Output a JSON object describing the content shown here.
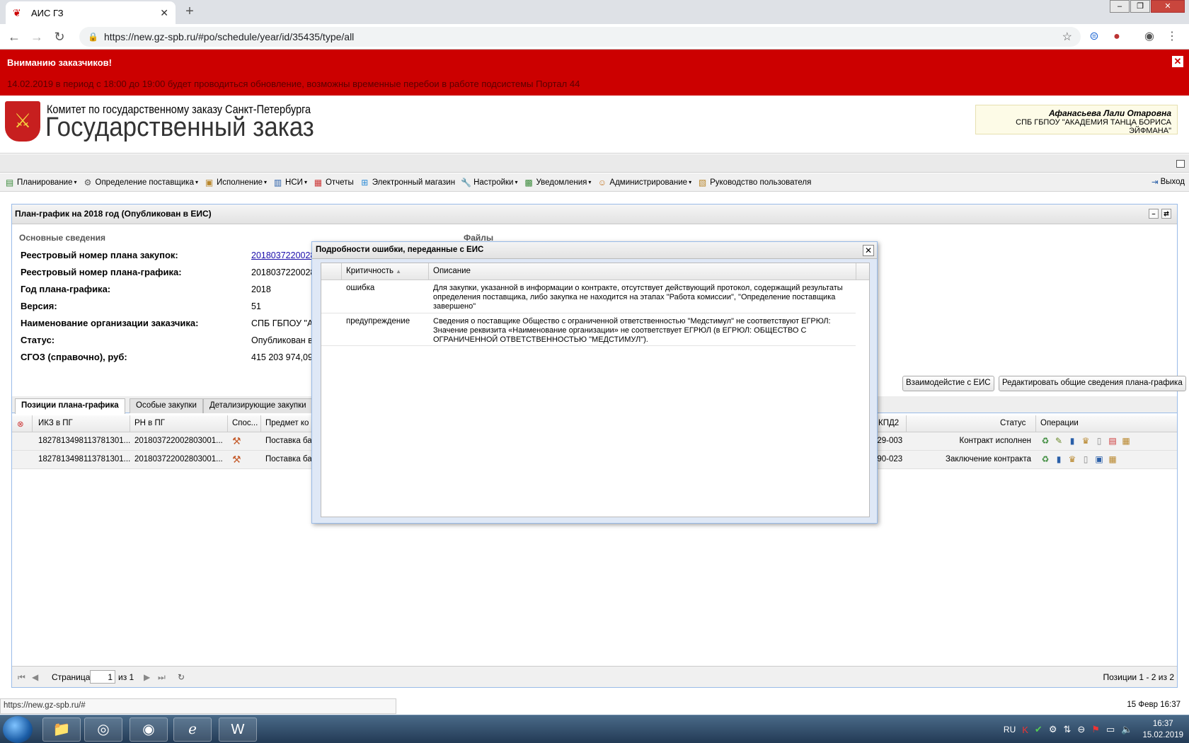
{
  "browser": {
    "tab_title": "АИС ГЗ",
    "url": "https://new.gz-spb.ru/#po/schedule/year/id/35435/type/all"
  },
  "banner": {
    "title": "Вниманию заказчиков!",
    "message": "14.02.2019 в период с 18:00 до 19:00 будет проводиться обновление, возможны временные перебои в работе подсистемы Портал 44",
    "close": "✕"
  },
  "header": {
    "org_line": "Комитет по государственному заказу Санкт-Петербурга",
    "system_name": "Государственный заказ",
    "user_name": "Афанасьева Лали Отаровна",
    "user_org": "СПБ ГБПОУ \"АКАДЕМИЯ ТАНЦА БОРИСА ЭЙФМАНА\""
  },
  "menu": {
    "items": [
      {
        "label": "Планирование",
        "icon": "planning-icon",
        "dropdown": true
      },
      {
        "label": "Определение поставщика",
        "icon": "supplier-icon",
        "dropdown": true
      },
      {
        "label": "Исполнение",
        "icon": "execution-icon",
        "dropdown": true
      },
      {
        "label": "НСИ",
        "icon": "book-icon",
        "dropdown": true
      },
      {
        "label": "Отчеты",
        "icon": "report-icon",
        "dropdown": false
      },
      {
        "label": "Электронный магазин",
        "icon": "cart-icon",
        "dropdown": false
      },
      {
        "label": "Настройки",
        "icon": "wrench-icon",
        "dropdown": true
      },
      {
        "label": "Уведомления",
        "icon": "notification-icon",
        "dropdown": true
      },
      {
        "label": "Администрирование",
        "icon": "admin-icon",
        "dropdown": true
      },
      {
        "label": "Руководство пользователя",
        "icon": "manual-icon",
        "dropdown": false
      }
    ],
    "logout": "Выход"
  },
  "panel": {
    "title": "План-график на 2018 год (Опубликован в ЕИС)",
    "section_main": "Основные сведения",
    "section_files": "Файлы",
    "fields": [
      {
        "label": "Реестровый номер плана закупок:",
        "value": "2018037220028"
      },
      {
        "label": "Реестровый номер плана-графика:",
        "value": "2018037220028"
      },
      {
        "label": "Год плана-графика:",
        "value": "2018"
      },
      {
        "label": "Версия:",
        "value": "51"
      },
      {
        "label": "Наименование организации заказчика:",
        "value": "СПБ ГБПОУ \"АК"
      },
      {
        "label": "Статус:",
        "value": "Опубликован в"
      },
      {
        "label": "СГОЗ (справочно), руб:",
        "value": "415 203 974,09"
      }
    ],
    "btn_eis": "Взаимодейстие с ЕИС",
    "btn_edit": "Редактировать общие сведения плана-графика",
    "tabs": [
      "Позиции плана-графика",
      "Особые закупки",
      "Детализирующие закупки"
    ]
  },
  "grid": {
    "columns": {
      "ikz": "ИКЗ в ПГ",
      "rn": "РН в ПГ",
      "method": "Спос...",
      "subject": "Предмет ко",
      "okpd": "КПД2",
      "status": "Статус",
      "ops": "Операции"
    },
    "rows": [
      {
        "ikz": "1827813498113781301...",
        "rn": "201803722002803001...",
        "subject": "Поставка ба",
        "okpd": "129-003",
        "status": "Контракт исполнен"
      },
      {
        "ikz": "1827813498113781301...",
        "rn": "201803722002803001...",
        "subject": "Поставка ба",
        "okpd": "190-023",
        "status": "Заключение контракта"
      }
    ]
  },
  "pager": {
    "page_label": "Страница",
    "page_value": "1",
    "of_label": "из 1",
    "summary": "Позиции 1 - 2 из 2"
  },
  "dialog": {
    "title": "Подробности ошибки, переданные с ЕИС",
    "col_severity": "Критичность",
    "col_description": "Описание",
    "rows": [
      {
        "severity": "ошибка",
        "description": "Для закупки, указанной в информации о контракте, отсутствует действующий протокол, содержащий результаты определения поставщика, либо закупка не находится на этапах \"Работа комиссии\", \"Определение поставщика завершено\""
      },
      {
        "severity": "предупреждение",
        "description": "Сведения о поставщике Общество с ограниченной ответственностью \"Медстимул\" не соответствуют ЕГРЮЛ: Значение реквизита «Наименование организации» не соответствует ЕГРЮЛ (в ЕГРЮЛ: ОБЩЕСТВО С ОГРАНИЧЕННОЙ ОТВЕТСТВЕННОСТЬЮ \"МЕДСТИМУЛ\")."
      }
    ]
  },
  "statusbar": {
    "url": "https://new.gz-spb.ru/#",
    "datetime": "15 Февр 16:37"
  },
  "taskbar": {
    "lang": "RU",
    "time": "16:37",
    "date": "15.02.2019"
  },
  "colors": {
    "banner": "#cc0000",
    "link": "#1a0dab",
    "panel_border": "#99bbe8"
  }
}
